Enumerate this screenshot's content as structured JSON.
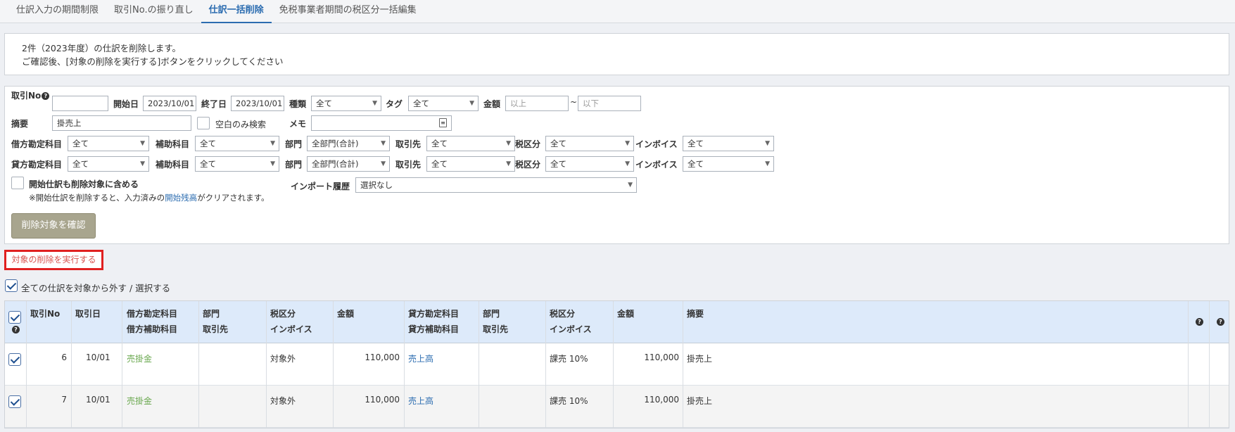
{
  "tabs": [
    "仕訳入力の期間制限",
    "取引No.の振り直し",
    "仕訳一括削除",
    "免税事業者期間の税区分一括編集"
  ],
  "info": {
    "line1": "2件（2023年度）の仕訳を削除します。",
    "line2": "ご確認後、[対象の削除を実行する]ボタンをクリックしてください"
  },
  "search": {
    "torihiki_no_label": "取引No",
    "start_label": "開始日",
    "start_value": "2023/10/01",
    "end_label": "終了日",
    "end_value": "2023/10/01",
    "type_label": "種類",
    "type_value": "全て",
    "tag_label": "タグ",
    "tag_value": "全て",
    "amount_label": "金額",
    "amount_min_placeholder": "以上",
    "tilde": "~",
    "amount_max_placeholder": "以下",
    "summary_label": "摘要",
    "summary_value": "掛売上",
    "blank_only_label": "空白のみ検索",
    "memo_label": "メモ",
    "debit_label": "借方勘定科目",
    "credit_label": "貸方勘定科目",
    "sub_label": "補助科目",
    "dept_label": "部門",
    "partner_label": "取引先",
    "tax_label": "税区分",
    "invoice_label": "インボイス",
    "all": "全て",
    "dept_value": "全部門(合計)",
    "include_opening_label": "開始仕訳も削除対象に含める",
    "note_before": "※開始仕訳を削除すると、入力済みの",
    "note_link": "開始残高",
    "note_after": "がクリアされます。",
    "import_label": "インポート履歴",
    "import_value": "選択なし",
    "confirm_button": "削除対象を確認"
  },
  "execute_link": "対象の削除を実行する",
  "select_all_label": "全ての仕訳を対象から外す / 選択する",
  "table": {
    "headers": {
      "no": "取引No",
      "date": "取引日",
      "debit1": "借方勘定科目",
      "debit2": "借方補助科目",
      "dept1": "部門",
      "dept2": "取引先",
      "tax1": "税区分",
      "tax2": "インボイス",
      "amount": "金額",
      "credit1": "貸方勘定科目",
      "credit2": "貸方補助科目",
      "cdept1": "部門",
      "cdept2": "取引先",
      "ctax1": "税区分",
      "ctax2": "インボイス",
      "camount": "金額",
      "summary": "摘要"
    },
    "rows": [
      {
        "no": "6",
        "date": "10/01",
        "debit": "売掛金",
        "tax": "対象外",
        "amount": "110,000",
        "credit": "売上高",
        "ctax": "課売 10%",
        "camount": "110,000",
        "summary": "掛売上"
      },
      {
        "no": "7",
        "date": "10/01",
        "debit": "売掛金",
        "tax": "対象外",
        "amount": "110,000",
        "credit": "売上高",
        "ctax": "課売 10%",
        "camount": "110,000",
        "summary": "掛売上"
      }
    ]
  }
}
